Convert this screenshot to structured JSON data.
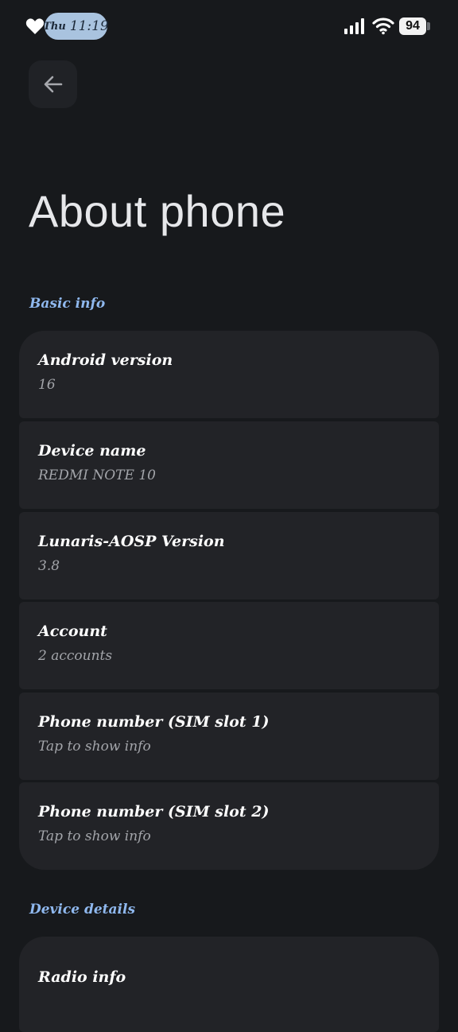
{
  "status_bar": {
    "day": "Thu",
    "time": "11:19",
    "battery": "94",
    "icons": [
      "heart-icon",
      "signal-icon",
      "wifi-icon",
      "battery-icon"
    ]
  },
  "header": {
    "back_icon": "arrow-left-icon",
    "title": "About phone"
  },
  "sections": [
    {
      "label": "Basic info",
      "items": [
        {
          "title": "Android version",
          "subtitle": "16"
        },
        {
          "title": "Device name",
          "subtitle": "REDMI NOTE 10"
        },
        {
          "title": "Lunaris-AOSP Version",
          "subtitle": "3.8"
        },
        {
          "title": "Account",
          "subtitle": "2 accounts"
        },
        {
          "title": "Phone number (SIM slot 1)",
          "subtitle": "Tap to show info"
        },
        {
          "title": "Phone number (SIM slot 2)",
          "subtitle": "Tap to show info"
        }
      ]
    },
    {
      "label": "Device details",
      "items": [
        {
          "title": "Radio info"
        }
      ]
    }
  ],
  "colors": {
    "background": "#17191c",
    "card": "#222327",
    "accent": "#8fb8ee",
    "time_pill": "#a9c3df"
  }
}
